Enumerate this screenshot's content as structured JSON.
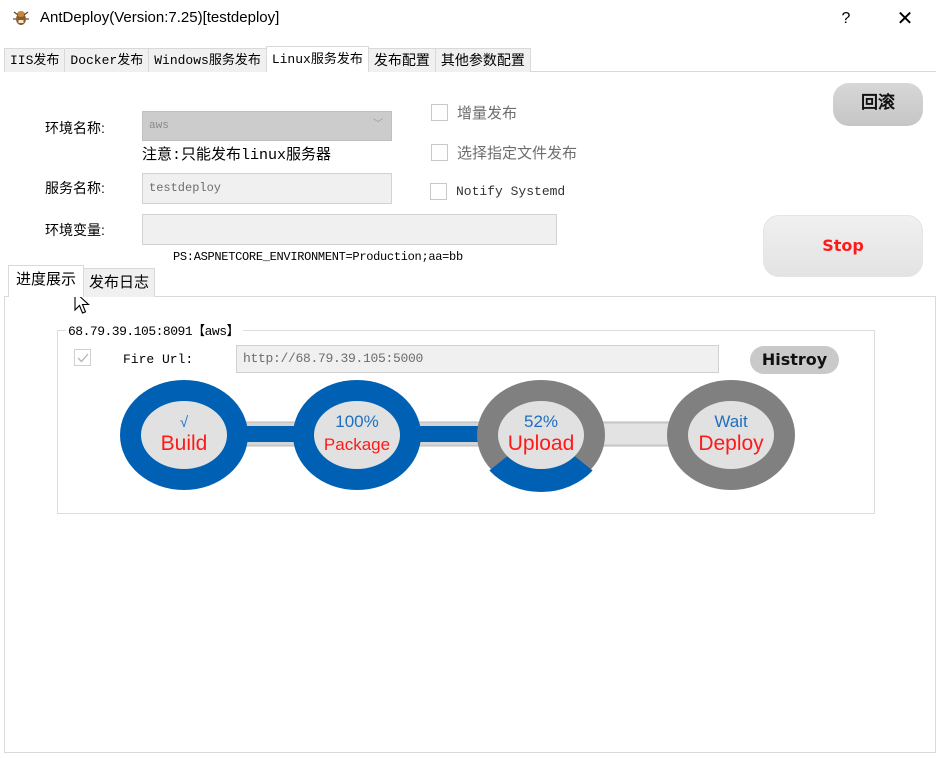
{
  "window": {
    "title": "AntDeploy(Version:7.25)[testdeploy]",
    "help_label": "?",
    "close_label": "✕"
  },
  "main_tabs": [
    {
      "label": "IIS发布",
      "active": false
    },
    {
      "label": "Docker发布",
      "active": false
    },
    {
      "label": "Windows服务发布",
      "active": false
    },
    {
      "label": "Linux服务发布",
      "active": true
    },
    {
      "label": "发布配置",
      "active": false
    },
    {
      "label": "其他参数配置",
      "active": false
    }
  ],
  "form": {
    "env_label": "环境名称:",
    "env_value": "aws",
    "env_note": "注意:只能发布linux服务器",
    "service_label": "服务名称:",
    "service_value": "testdeploy",
    "envvar_label": "环境变量:",
    "envvar_value": "",
    "envvar_hint": "PS:ASPNETCORE_ENVIRONMENT=Production;aa=bb"
  },
  "options": [
    {
      "label": "增量发布",
      "checked": false
    },
    {
      "label": "选择指定文件发布",
      "checked": false
    },
    {
      "label": "Notify Systemd",
      "checked": false
    }
  ],
  "buttons": {
    "rollback": "回滚",
    "stop": "Stop",
    "history": "Histroy"
  },
  "sub_tabs": [
    {
      "label": "进度展示",
      "active": true
    },
    {
      "label": "发布日志",
      "active": false
    }
  ],
  "server": {
    "title": "68.79.39.105:8091【aws】",
    "fire_checked": true,
    "fire_label": "Fire Url:",
    "fire_url": "http://68.79.39.105:5000"
  },
  "colors": {
    "done": "#0061b4",
    "pending": "#808080",
    "inner": "#e1e1e1",
    "status_text": "#1e6fc0",
    "step_name": "#ff1a1a",
    "stop_text": "#ff1a1a"
  },
  "steps": [
    {
      "name": "Build",
      "status": "√",
      "progress": 1.0,
      "state": "done"
    },
    {
      "name": "Package",
      "status": "100%",
      "progress": 1.0,
      "state": "done"
    },
    {
      "name": "Upload",
      "status": "52%",
      "progress": 0.52,
      "state": "running"
    },
    {
      "name": "Deploy",
      "status": "Wait",
      "progress": 0.0,
      "state": "waiting"
    }
  ],
  "connectors": [
    {
      "from": "Build",
      "to": "Package",
      "filled": true
    },
    {
      "from": "Package",
      "to": "Upload",
      "filled": true
    },
    {
      "from": "Upload",
      "to": "Deploy",
      "filled": false
    }
  ]
}
